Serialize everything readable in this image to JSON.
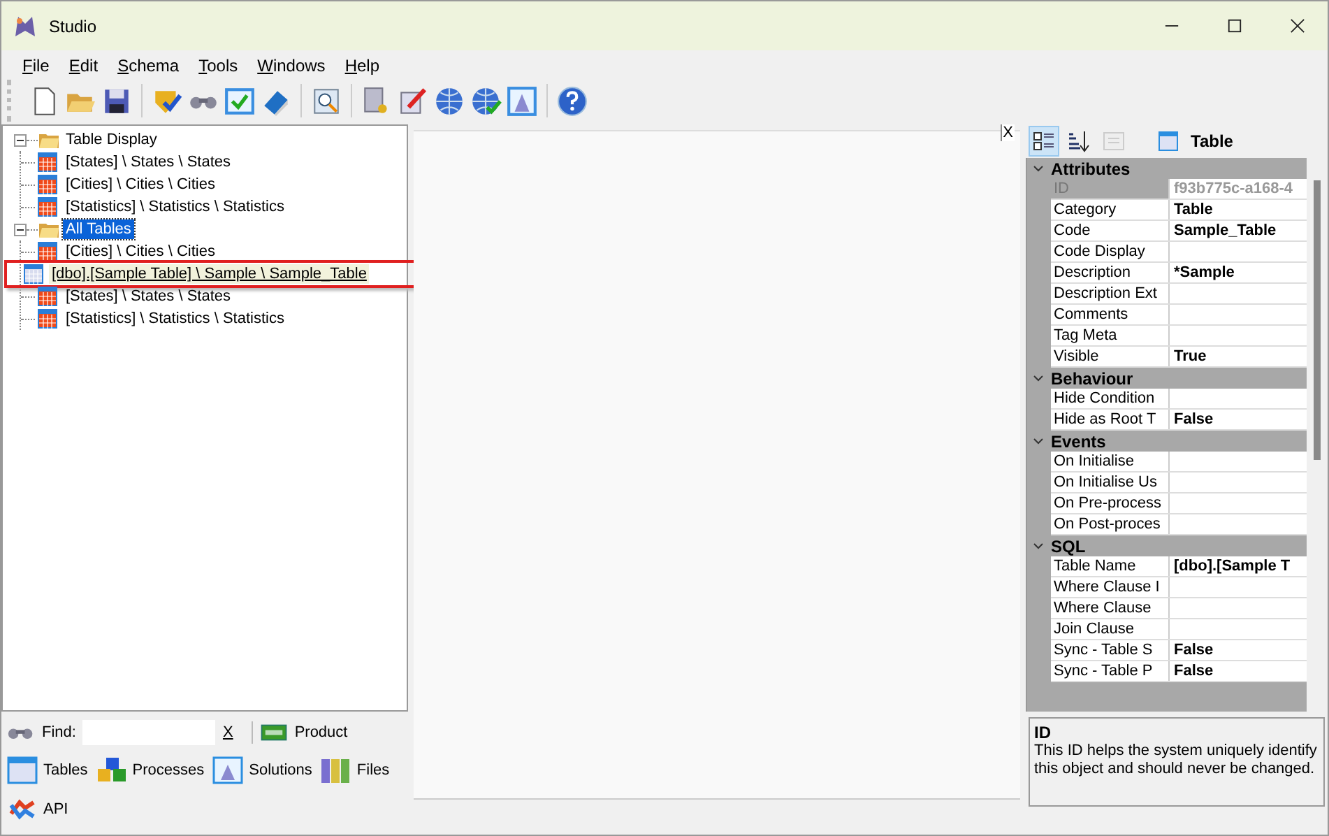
{
  "window": {
    "title": "Studio"
  },
  "menu": [
    "File",
    "Edit",
    "Schema",
    "Tools",
    "Windows",
    "Help"
  ],
  "tree": [
    {
      "label": "Table Display",
      "kind": "folder",
      "selected": false,
      "expanded": true,
      "children": [
        {
          "label": "[States] \\ States \\ States",
          "kind": "table",
          "selected": false,
          "outlined": false
        },
        {
          "label": "[Cities] \\ Cities \\ Cities",
          "kind": "table",
          "selected": false,
          "outlined": false
        },
        {
          "label": "[Statistics] \\ Statistics \\ Statistics",
          "kind": "table",
          "selected": false,
          "outlined": false
        }
      ]
    },
    {
      "label": "All Tables",
      "kind": "folder",
      "selected": true,
      "expanded": true,
      "children": [
        {
          "label": "[Cities] \\ Cities \\ Cities",
          "kind": "table",
          "selected": false,
          "outlined": false
        },
        {
          "label": "[dbo].[Sample Table] \\ Sample \\ Sample_Table",
          "kind": "draft",
          "selected": false,
          "outlined": true
        },
        {
          "label": "[States] \\ States \\ States",
          "kind": "table",
          "selected": false,
          "outlined": false
        },
        {
          "label": "[Statistics] \\ Statistics \\ Statistics",
          "kind": "table",
          "selected": false,
          "outlined": false
        }
      ]
    }
  ],
  "find": {
    "label": "Find:",
    "clear": "X",
    "product": "Product"
  },
  "nav": [
    {
      "label": "Tables",
      "kind": "tables"
    },
    {
      "label": "Processes",
      "kind": "processes"
    },
    {
      "label": "Solutions",
      "kind": "solutions"
    },
    {
      "label": "Files",
      "kind": "files"
    },
    {
      "label": "API",
      "kind": "api"
    }
  ],
  "document": {
    "close": "X"
  },
  "properties": {
    "view": [
      {
        "kind": "categorized",
        "selected": true,
        "disabled": false
      },
      {
        "kind": "alphabetical",
        "selected": false,
        "disabled": false
      },
      {
        "kind": "pages",
        "selected": false,
        "disabled": true
      }
    ],
    "object_type": "Table",
    "categories": [
      {
        "name": "Attributes",
        "expanded": true,
        "rows": [
          {
            "name": "ID",
            "value": "f93b775c-a168-4",
            "disabled": true
          },
          {
            "name": "Category",
            "value": "Table",
            "disabled": false
          },
          {
            "name": "Code",
            "value": "Sample_Table",
            "disabled": false
          },
          {
            "name": "Code Display",
            "value": "",
            "disabled": false
          },
          {
            "name": "Description",
            "value": "*Sample",
            "disabled": false
          },
          {
            "name": "Description Ext",
            "value": "",
            "disabled": false
          },
          {
            "name": "Comments",
            "value": "",
            "disabled": false
          },
          {
            "name": "Tag Meta",
            "value": "",
            "disabled": false
          },
          {
            "name": "Visible",
            "value": "True",
            "disabled": false
          }
        ]
      },
      {
        "name": "Behaviour",
        "expanded": true,
        "rows": [
          {
            "name": "Hide Condition",
            "value": "",
            "disabled": false
          },
          {
            "name": "Hide as Root T",
            "value": "False",
            "disabled": false
          }
        ]
      },
      {
        "name": "Events",
        "expanded": true,
        "rows": [
          {
            "name": "On Initialise",
            "value": "",
            "disabled": false
          },
          {
            "name": "On Initialise Us",
            "value": "",
            "disabled": false
          },
          {
            "name": "On Pre-process",
            "value": "",
            "disabled": false
          },
          {
            "name": "On Post-proces",
            "value": "",
            "disabled": false
          }
        ]
      },
      {
        "name": "SQL",
        "expanded": true,
        "rows": [
          {
            "name": "Table Name",
            "value": "[dbo].[Sample T",
            "disabled": false
          },
          {
            "name": "Where Clause I",
            "value": "",
            "disabled": false
          },
          {
            "name": "Where Clause",
            "value": "",
            "disabled": false
          },
          {
            "name": "Join Clause",
            "value": "",
            "disabled": false
          },
          {
            "name": "Sync - Table S",
            "value": "False",
            "disabled": false
          },
          {
            "name": "Sync - Table P",
            "value": "False",
            "disabled": false
          }
        ]
      }
    ],
    "help": {
      "title": "ID",
      "text": "This ID helps the system uniquely identify this object and should never be changed."
    }
  }
}
